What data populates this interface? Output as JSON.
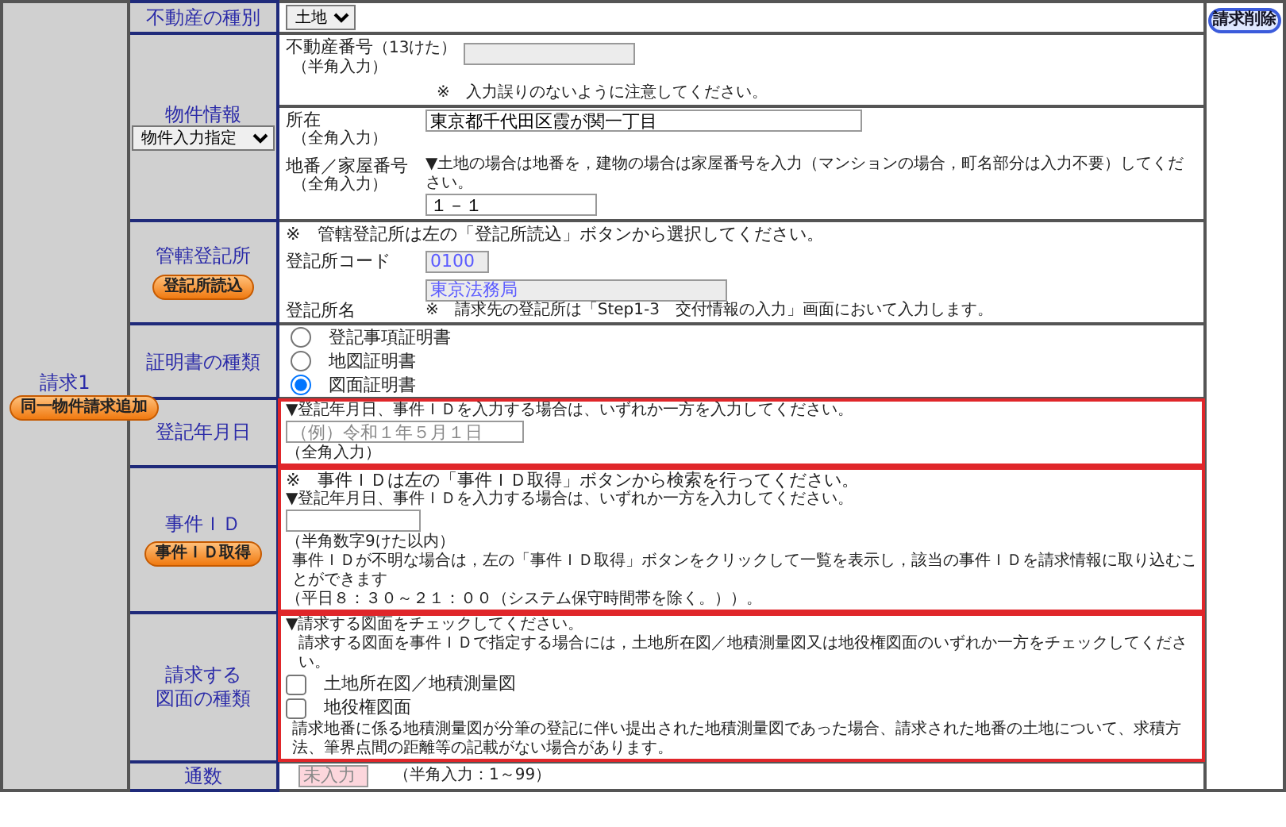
{
  "request": {
    "title": "請求1",
    "add_button": "同一物件請求追加"
  },
  "delete_button": "請求削除",
  "property_type": {
    "label": "不動産の種別",
    "select": "土地"
  },
  "property_info": {
    "label": "物件情報",
    "select": "物件入力指定",
    "number": {
      "label": "不動産番号",
      "label_note": "（13けた）",
      "sub": "（半角入力）",
      "disabled": true,
      "note": "※　入力誤りのないように注意してください。"
    },
    "location": {
      "label": "所在",
      "sub": "（全角入力）",
      "value": "東京都千代田区霞が関一丁目"
    },
    "lot": {
      "label": "地番／家屋番号",
      "sub": "（全角入力）",
      "hint": "▼土地の場合は地番を，建物の場合は家屋番号を入力（マンションの場合，町名部分は入力不要）してください。",
      "value": "１－１"
    }
  },
  "registry": {
    "label": "管轄登記所",
    "button": "登記所読込",
    "note": "※　管轄登記所は左の「登記所読込」ボタンから選択してください。",
    "code_label": "登記所コード",
    "code": "0100",
    "name_label": "登記所名",
    "name": "東京法務局",
    "readonly": true,
    "name_note": "※　請求先の登記所は「Step1-3　交付情報の入力」画面において入力します。"
  },
  "certificate": {
    "label": "証明書の種類",
    "options": [
      {
        "label": "登記事項証明書",
        "selected": false
      },
      {
        "label": "地図証明書",
        "selected": false
      },
      {
        "label": "図面証明書",
        "selected": true
      }
    ]
  },
  "date": {
    "label": "登記年月日",
    "highlighted": true,
    "hint": "▼登記年月日、事件ＩＤを入力する場合は、いずれか一方を入力してください。",
    "placeholder": "（例）令和１年５月１日",
    "sub": "（全角入力）"
  },
  "case_id": {
    "label": "事件ＩＤ",
    "button": "事件ＩＤ取得",
    "highlighted": true,
    "note": "※　事件ＩＤは左の「事件ＩＤ取得」ボタンから検索を行ってください。",
    "hint": "▼登記年月日、事件ＩＤを入力する場合は、いずれか一方を入力してください。",
    "sub": "（半角数字9けた以内）",
    "info": "事件ＩＤが不明な場合は，左の「事件ＩＤ取得」ボタンをクリックして一覧を表示し，該当の事件ＩＤを請求情報に取り込むことができます",
    "hours": "（平日８：３０～２１：００（システム保守時間帯を除く。））。"
  },
  "drawings": {
    "label_lines": [
      "請求する",
      "図面の種類"
    ],
    "highlighted": true,
    "hint": "▼請求する図面をチェックしてください。",
    "note": "請求する図面を事件ＩＤで指定する場合には，土地所在図／地積測量図又は地役権図面のいずれか一方をチェックしてください。",
    "options": [
      {
        "label": "土地所在図／地積測量図",
        "checked": false
      },
      {
        "label": "地役権図面",
        "checked": false
      }
    ],
    "footnote": "請求地番に係る地積測量図が分筆の登記に伴い提出された地積測量図であった場合、請求された地番の土地について、求積方法、筆界点間の距離等の記載がない場合があります。"
  },
  "copies": {
    "label": "通数",
    "placeholder": "未入力",
    "invalid": true,
    "sub": "（半角入力：1～99）"
  }
}
